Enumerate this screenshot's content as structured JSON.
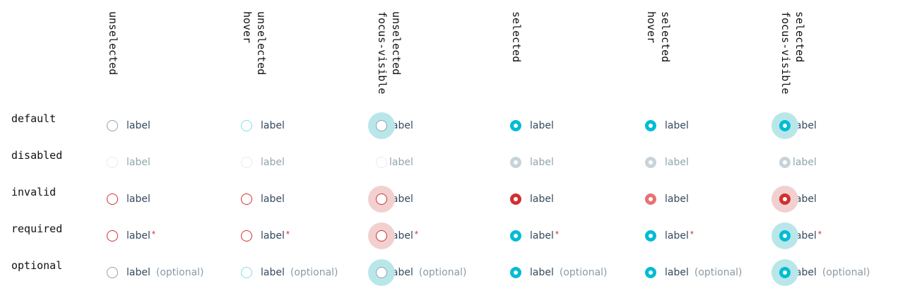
{
  "columns": [
    {
      "line1": "unselected",
      "line2": ""
    },
    {
      "line1": "hover",
      "line2": "unselected"
    },
    {
      "line1": "focus-visible",
      "line2": "unselected"
    },
    {
      "line1": "selected",
      "line2": ""
    },
    {
      "line1": "hover",
      "line2": "selected"
    },
    {
      "line1": "focus-visible",
      "line2": "selected"
    }
  ],
  "rows": [
    {
      "label": "default"
    },
    {
      "label": "disabled"
    },
    {
      "label": "invalid"
    },
    {
      "label": "required"
    },
    {
      "label": "optional"
    }
  ],
  "radio_label": "label",
  "required_marker": "*",
  "optional_text": "(optional)",
  "colors": {
    "teal": "#00bcd4",
    "teal_hover_border": "#80deea",
    "teal_halo": "#b9e7e9",
    "neutral_border": "#90a4ae",
    "disabled_border": "#e6ecef",
    "disabled_selected": "#c7d3d9",
    "invalid": "#d32f2f",
    "invalid_hover": "#e57373",
    "invalid_halo": "#f2d0d0"
  }
}
